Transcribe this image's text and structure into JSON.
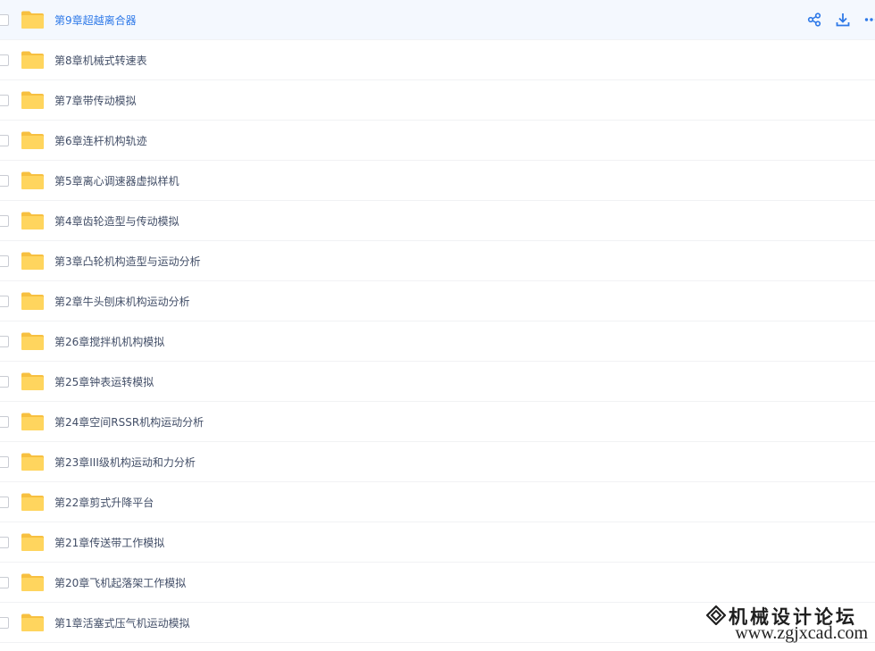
{
  "files": [
    {
      "name": "第9章超越离合器",
      "selected": true
    },
    {
      "name": "第8章机械式转速表"
    },
    {
      "name": "第7章带传动模拟"
    },
    {
      "name": "第6章连杆机构轨迹"
    },
    {
      "name": "第5章离心调速器虚拟样机"
    },
    {
      "name": "第4章齿轮造型与传动模拟"
    },
    {
      "name": "第3章凸轮机构造型与运动分析"
    },
    {
      "name": "第2章牛头刨床机构运动分析"
    },
    {
      "name": "第26章搅拌机机构模拟"
    },
    {
      "name": "第25章钟表运转模拟"
    },
    {
      "name": "第24章空间RSSR机构运动分析"
    },
    {
      "name": "第23章III级机构运动和力分析"
    },
    {
      "name": "第22章剪式升降平台"
    },
    {
      "name": "第21章传送带工作模拟"
    },
    {
      "name": "第20章飞机起落架工作模拟"
    },
    {
      "name": "第1章活塞式压气机运动模拟"
    }
  ],
  "row_actions": [
    "share-icon",
    "download-icon",
    "more-icon"
  ],
  "watermark": {
    "title": "机械设计论坛",
    "url": "www.zgjxcad.com"
  },
  "colors": {
    "folder": "#ffd157",
    "accent": "#2e79e8",
    "text": "#424e67",
    "selected_bg": "#f4f8fe"
  }
}
